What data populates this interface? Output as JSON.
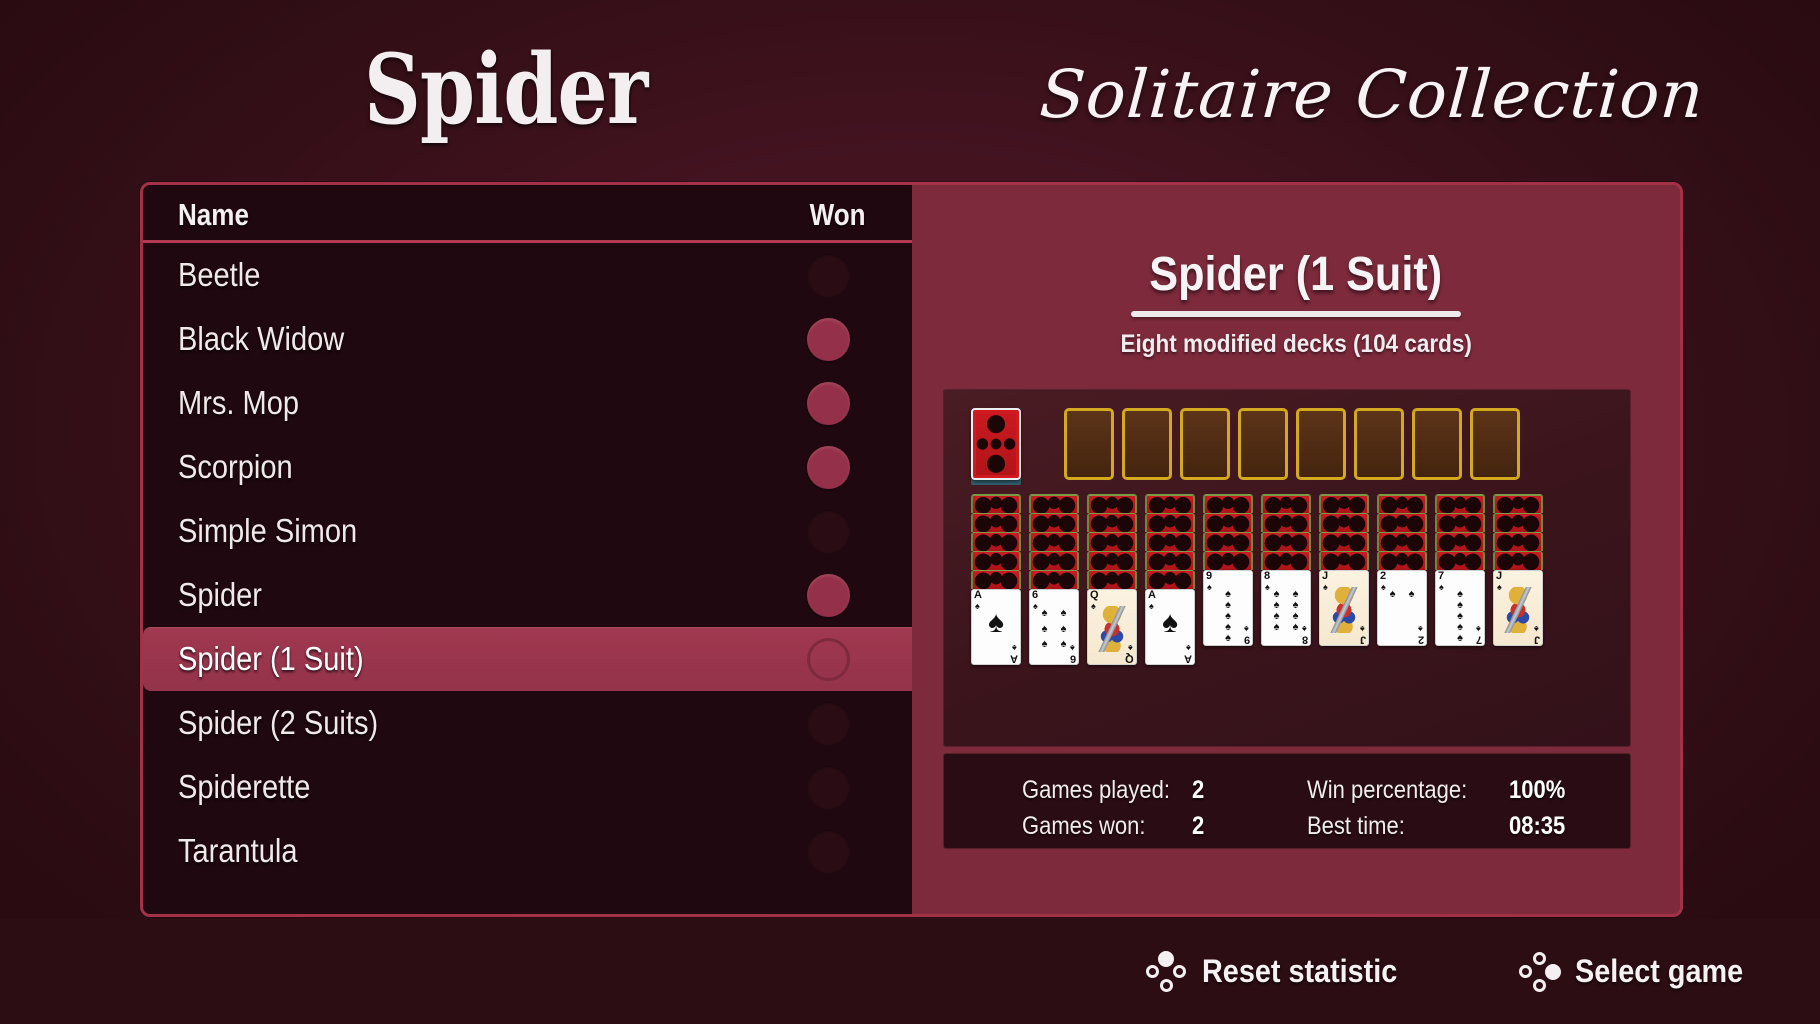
{
  "header": {
    "title_main": "Spider",
    "title_sub": "Solitaire Collection"
  },
  "colors": {
    "background": "#431320",
    "panel_dark": "#200810",
    "panel_light": "#7d2a3c",
    "border_accent": "#a33148",
    "selection": "#a03850",
    "won_dot": "#95304a",
    "slot_border": "#d4a81f",
    "text": "#f1ecee"
  },
  "list": {
    "columns": {
      "name": "Name",
      "won": "Won"
    },
    "items": [
      {
        "label": "Beetle",
        "won": false,
        "selected": false
      },
      {
        "label": "Black Widow",
        "won": true,
        "selected": false
      },
      {
        "label": "Mrs. Mop",
        "won": true,
        "selected": false
      },
      {
        "label": "Scorpion",
        "won": true,
        "selected": false
      },
      {
        "label": "Simple Simon",
        "won": false,
        "selected": false
      },
      {
        "label": "Spider",
        "won": true,
        "selected": false
      },
      {
        "label": "Spider (1 Suit)",
        "won": false,
        "selected": true
      },
      {
        "label": "Spider (2 Suits)",
        "won": false,
        "selected": false
      },
      {
        "label": "Spiderette",
        "won": false,
        "selected": false
      },
      {
        "label": "Tarantula",
        "won": false,
        "selected": false
      }
    ]
  },
  "detail": {
    "title": "Spider (1 Suit)",
    "subtitle": "Eight modified decks (104 cards)",
    "preview": {
      "stock_cards": 1,
      "foundation_slots": 8,
      "tableau": [
        {
          "facedown": 5,
          "faceup": {
            "rank": "A",
            "suit": "spades",
            "court": false
          }
        },
        {
          "facedown": 5,
          "faceup": {
            "rank": "6",
            "suit": "spades",
            "court": false
          }
        },
        {
          "facedown": 5,
          "faceup": {
            "rank": "Q",
            "suit": "spades",
            "court": true
          }
        },
        {
          "facedown": 5,
          "faceup": {
            "rank": "A",
            "suit": "spades",
            "court": false
          }
        },
        {
          "facedown": 4,
          "faceup": {
            "rank": "9",
            "suit": "spades",
            "court": false
          }
        },
        {
          "facedown": 4,
          "faceup": {
            "rank": "8",
            "suit": "spades",
            "court": false
          }
        },
        {
          "facedown": 4,
          "faceup": {
            "rank": "J",
            "suit": "spades",
            "court": true
          }
        },
        {
          "facedown": 4,
          "faceup": {
            "rank": "2",
            "suit": "spades",
            "court": false
          }
        },
        {
          "facedown": 4,
          "faceup": {
            "rank": "7",
            "suit": "spades",
            "court": false
          }
        },
        {
          "facedown": 4,
          "faceup": {
            "rank": "J",
            "suit": "spades",
            "court": true
          }
        }
      ]
    },
    "stats": {
      "games_played_label": "Games played:",
      "games_played_value": "2",
      "games_won_label": "Games won:",
      "games_won_value": "2",
      "win_percentage_label": "Win percentage:",
      "win_percentage_value": "100%",
      "best_time_label": "Best time:",
      "best_time_value": "08:35"
    }
  },
  "footer": {
    "actions": [
      {
        "label": "Reset statistic",
        "icon": "gamepad-button-top-icon",
        "filled": "t"
      },
      {
        "label": "Select game",
        "icon": "gamepad-button-right-icon",
        "filled": "r"
      }
    ]
  }
}
